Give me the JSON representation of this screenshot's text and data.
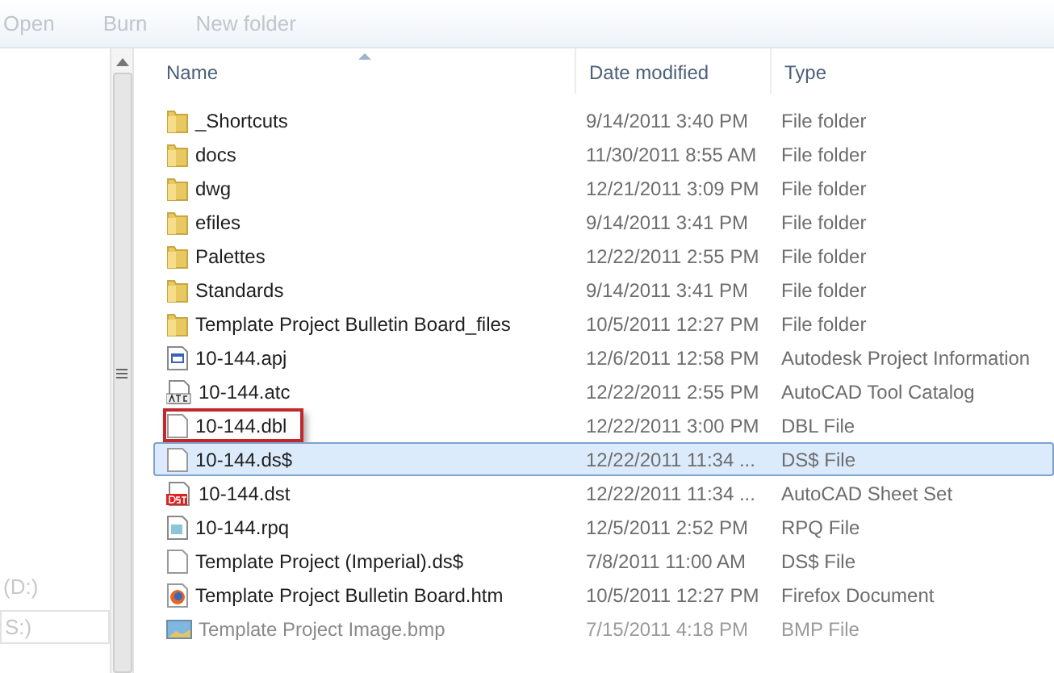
{
  "toolbar": {
    "buttons": [
      "Open",
      "Burn",
      "New folder"
    ]
  },
  "nav_pane": {
    "items": [
      "(D:)",
      "S:)"
    ]
  },
  "columns": [
    {
      "label": "Name",
      "sorted": true
    },
    {
      "label": "Date modified",
      "sorted": false
    },
    {
      "label": "Type",
      "sorted": false
    }
  ],
  "files": [
    {
      "name": "_Shortcuts",
      "date": "9/14/2011 3:40 PM",
      "type": "File folder",
      "kind": "folder",
      "selected": false,
      "callout": false,
      "faded": false
    },
    {
      "name": "docs",
      "date": "11/30/2011 8:55 AM",
      "type": "File folder",
      "kind": "folder",
      "selected": false,
      "callout": false,
      "faded": false
    },
    {
      "name": "dwg",
      "date": "12/21/2011 3:09 PM",
      "type": "File folder",
      "kind": "folder",
      "selected": false,
      "callout": false,
      "faded": false
    },
    {
      "name": "efiles",
      "date": "9/14/2011 3:41 PM",
      "type": "File folder",
      "kind": "folder",
      "selected": false,
      "callout": false,
      "faded": false
    },
    {
      "name": "Palettes",
      "date": "12/22/2011 2:55 PM",
      "type": "File folder",
      "kind": "folder",
      "selected": false,
      "callout": false,
      "faded": false
    },
    {
      "name": "Standards",
      "date": "9/14/2011 3:41 PM",
      "type": "File folder",
      "kind": "folder",
      "selected": false,
      "callout": false,
      "faded": false
    },
    {
      "name": "Template Project Bulletin Board_files",
      "date": "10/5/2011 12:27 PM",
      "type": "File folder",
      "kind": "folder",
      "selected": false,
      "callout": false,
      "faded": false
    },
    {
      "name": "10-144.apj",
      "date": "12/6/2011 12:58 PM",
      "type": "Autodesk Project Information",
      "kind": "apj",
      "selected": false,
      "callout": false,
      "faded": false
    },
    {
      "name": "10-144.atc",
      "date": "12/22/2011 2:55 PM",
      "type": "AutoCAD Tool Catalog",
      "kind": "atc",
      "selected": false,
      "callout": false,
      "faded": false
    },
    {
      "name": "10-144.dbl",
      "date": "12/22/2011 3:00 PM",
      "type": "DBL File",
      "kind": "blank",
      "selected": false,
      "callout": true,
      "faded": false
    },
    {
      "name": "10-144.ds$",
      "date": "12/22/2011 11:34 ...",
      "type": "DS$ File",
      "kind": "blank",
      "selected": true,
      "callout": false,
      "faded": false
    },
    {
      "name": "10-144.dst",
      "date": "12/22/2011 11:34 ...",
      "type": "AutoCAD Sheet Set",
      "kind": "dst",
      "selected": false,
      "callout": false,
      "faded": false
    },
    {
      "name": "10-144.rpq",
      "date": "12/5/2011 2:52 PM",
      "type": "RPQ File",
      "kind": "rpq",
      "selected": false,
      "callout": false,
      "faded": false
    },
    {
      "name": "Template Project (Imperial).ds$",
      "date": "7/8/2011 11:00 AM",
      "type": "DS$ File",
      "kind": "blank",
      "selected": false,
      "callout": false,
      "faded": false
    },
    {
      "name": "Template Project Bulletin Board.htm",
      "date": "10/5/2011 12:27 PM",
      "type": "Firefox Document",
      "kind": "htm",
      "selected": false,
      "callout": false,
      "faded": false
    },
    {
      "name": "Template Project Image.bmp",
      "date": "7/15/2011 4:18 PM",
      "type": "BMP File",
      "kind": "bmp",
      "selected": false,
      "callout": false,
      "faded": true
    }
  ]
}
